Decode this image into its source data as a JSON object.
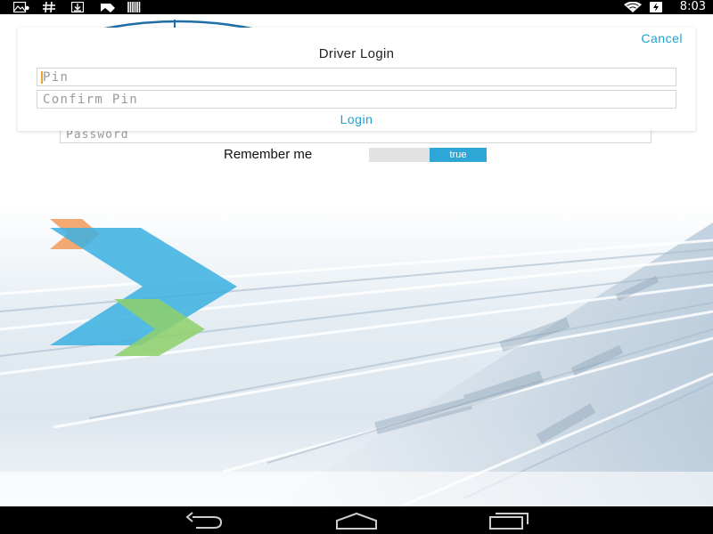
{
  "status_bar": {
    "time": "8:03",
    "icons_left": [
      "gallery-icon",
      "hash-icon",
      "download-icon",
      "nfc-icon",
      "barcode-icon"
    ],
    "icons_right": [
      "wifi-icon",
      "battery-charging-icon"
    ]
  },
  "dialog": {
    "cancel_label": "Cancel",
    "title": "Driver Login",
    "pin_placeholder": "Pin",
    "confirm_pin_placeholder": "Confirm Pin",
    "login_label": "Login"
  },
  "background_form": {
    "password_placeholder": "Password",
    "remember_label": "Remember me",
    "remember_value": "true"
  },
  "nav_bar": {
    "buttons": [
      "back-icon",
      "home-icon",
      "recents-icon"
    ]
  },
  "colors": {
    "accent": "#1aa3d4",
    "toggle_on": "#2ea6d6",
    "caret": "#f0a030",
    "hero_blue": "#3ab0e0",
    "hero_green": "#8ed06a",
    "hero_orange": "#f2a062"
  }
}
